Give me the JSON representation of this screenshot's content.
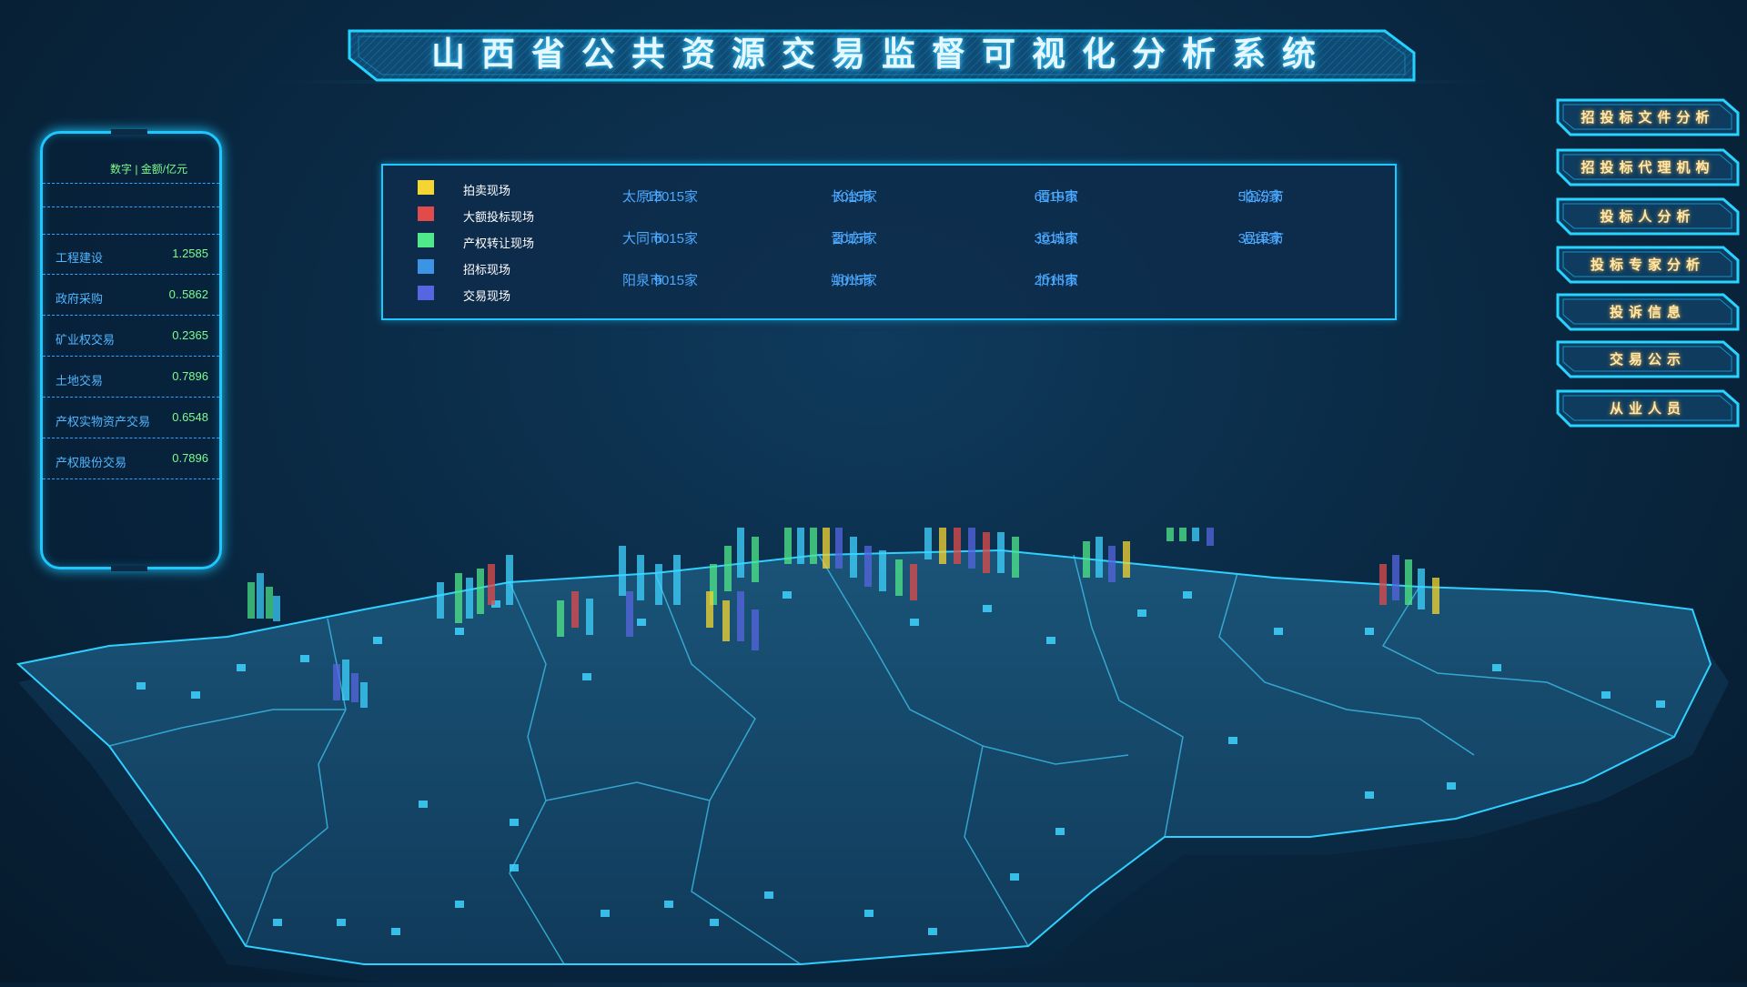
{
  "title": "山西省公共资源交易监督可视化分析系统",
  "left_panel": {
    "unit_label": "数字 | 金额/亿元",
    "rows": [
      {
        "name": "工程建设",
        "value": "1.2585"
      },
      {
        "name": "政府采购",
        "value": "0..5862"
      },
      {
        "name": "矿业权交易",
        "value": "0.2365"
      },
      {
        "name": "土地交易",
        "value": "0.7896"
      },
      {
        "name": "产权实物资产交易",
        "value": "0.6548"
      },
      {
        "name": "产权股份交易",
        "value": "0.7896"
      }
    ]
  },
  "legend": [
    {
      "label": "拍卖现场",
      "color": "#f5d532"
    },
    {
      "label": "大额投标现场",
      "color": "#e24b4b"
    },
    {
      "label": "产权转让现场",
      "color": "#4fe88a"
    },
    {
      "label": "招标现场",
      "color": "#3c94e6"
    },
    {
      "label": "交易现场",
      "color": "#5566e0"
    }
  ],
  "cities": [
    {
      "name": "太原市",
      "count": "12015家"
    },
    {
      "name": "长治市",
      "count": "7015家"
    },
    {
      "name": "晋中市",
      "count": "6015家"
    },
    {
      "name": "临汾市",
      "count": "5015家"
    },
    {
      "name": "大同市",
      "count": "6015家"
    },
    {
      "name": "晋城市",
      "count": "2015家"
    },
    {
      "name": "运城市",
      "count": "3015家"
    },
    {
      "name": "吕梁市",
      "count": "3015家"
    },
    {
      "name": "阳泉市",
      "count": "9015家"
    },
    {
      "name": "朔州市",
      "count": "1015家"
    },
    {
      "name": "忻州市",
      "count": "2015家"
    }
  ],
  "nav_buttons": [
    {
      "label": "招投标文件分析",
      "icon": "none"
    },
    {
      "label": "招投标代理机构",
      "icon": "none"
    },
    {
      "label": "投标人分析",
      "icon": "none"
    },
    {
      "label": "投标专家分析",
      "icon": "none"
    },
    {
      "label": "投诉信息",
      "icon": "none"
    },
    {
      "label": "交易公示",
      "icon": "none"
    },
    {
      "label": "从业人员",
      "icon": "none"
    }
  ],
  "colors": {
    "accent": "#1ec8ff",
    "value_green": "#7dfc8e",
    "city_blue": "#4aa8ff",
    "button_text": "#ffe8a8"
  }
}
